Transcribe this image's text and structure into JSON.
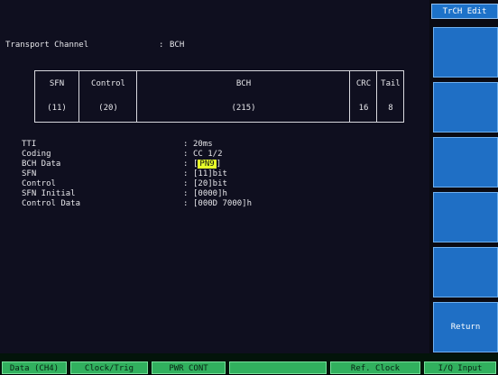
{
  "header": {
    "label": "Transport Channel",
    "colon": ":",
    "value": "BCH"
  },
  "frame_table": {
    "columns": [
      {
        "header": "SFN",
        "value": "(11)"
      },
      {
        "header": "Control",
        "value": "(20)"
      },
      {
        "header": "BCH",
        "value": "(215)"
      },
      {
        "header": "CRC",
        "value": "16"
      },
      {
        "header": "Tail",
        "value": "8"
      }
    ]
  },
  "params": [
    {
      "label": "TTI",
      "colon": ":",
      "value": "20ms"
    },
    {
      "label": "Coding",
      "colon": ":",
      "value": "CC 1/2"
    },
    {
      "label": "BCH Data",
      "colon": ":",
      "value_left": "[",
      "value_hl": "PN9",
      "value_right": "]"
    },
    {
      "label": "SFN",
      "colon": ":",
      "value": "[11]bit"
    },
    {
      "label": "Control",
      "colon": ":",
      "value": "[20]bit"
    },
    {
      "label": "SFN Initial",
      "colon": ":",
      "value": "[0000]h"
    },
    {
      "label": "Control Data",
      "colon": ":",
      "value": "[000D 7000]h"
    }
  ],
  "sidebar": {
    "title": "TrCH Edit",
    "buttons": [
      "",
      "",
      "",
      "",
      "",
      "Return"
    ]
  },
  "bottom": {
    "buttons": [
      "Data (CH4)",
      "Clock/Trig",
      "PWR CONT",
      "",
      "Ref. Clock",
      "I/Q Input"
    ]
  }
}
